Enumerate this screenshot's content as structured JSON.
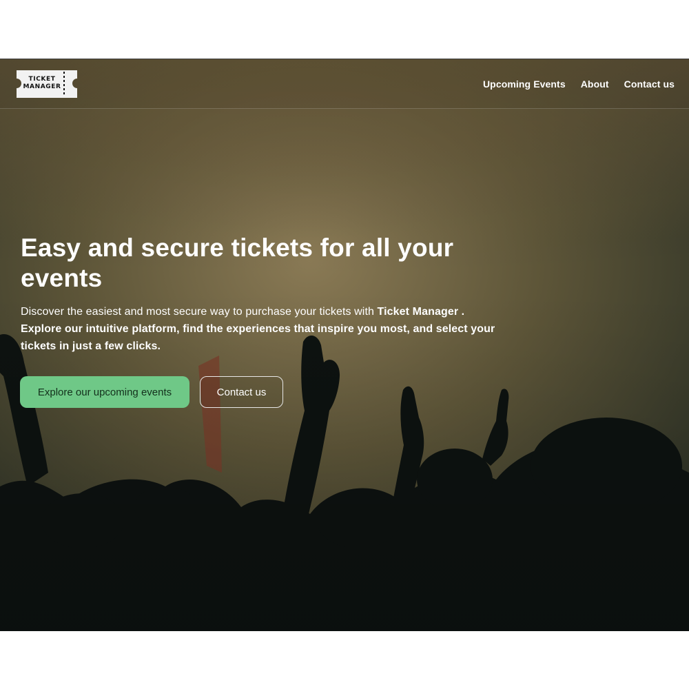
{
  "brand": {
    "logo_line1": "TICKET",
    "logo_line2": "MANAGER"
  },
  "nav": {
    "items": [
      "Upcoming Events",
      "About",
      "Contact us"
    ]
  },
  "hero": {
    "title": "Easy and secure tickets for all your events",
    "text_intro": "Discover the easiest and most secure way to purchase your tickets with ",
    "text_bold": "Ticket Manager . Explore our intuitive platform, find the experiences that inspire you most, and select your tickets in just a few clicks.",
    "primary_cta": "Explore our upcoming events",
    "secondary_cta": "Contact us"
  },
  "colors": {
    "accent": "#6fc887",
    "overlay_text": "#ffffff"
  }
}
